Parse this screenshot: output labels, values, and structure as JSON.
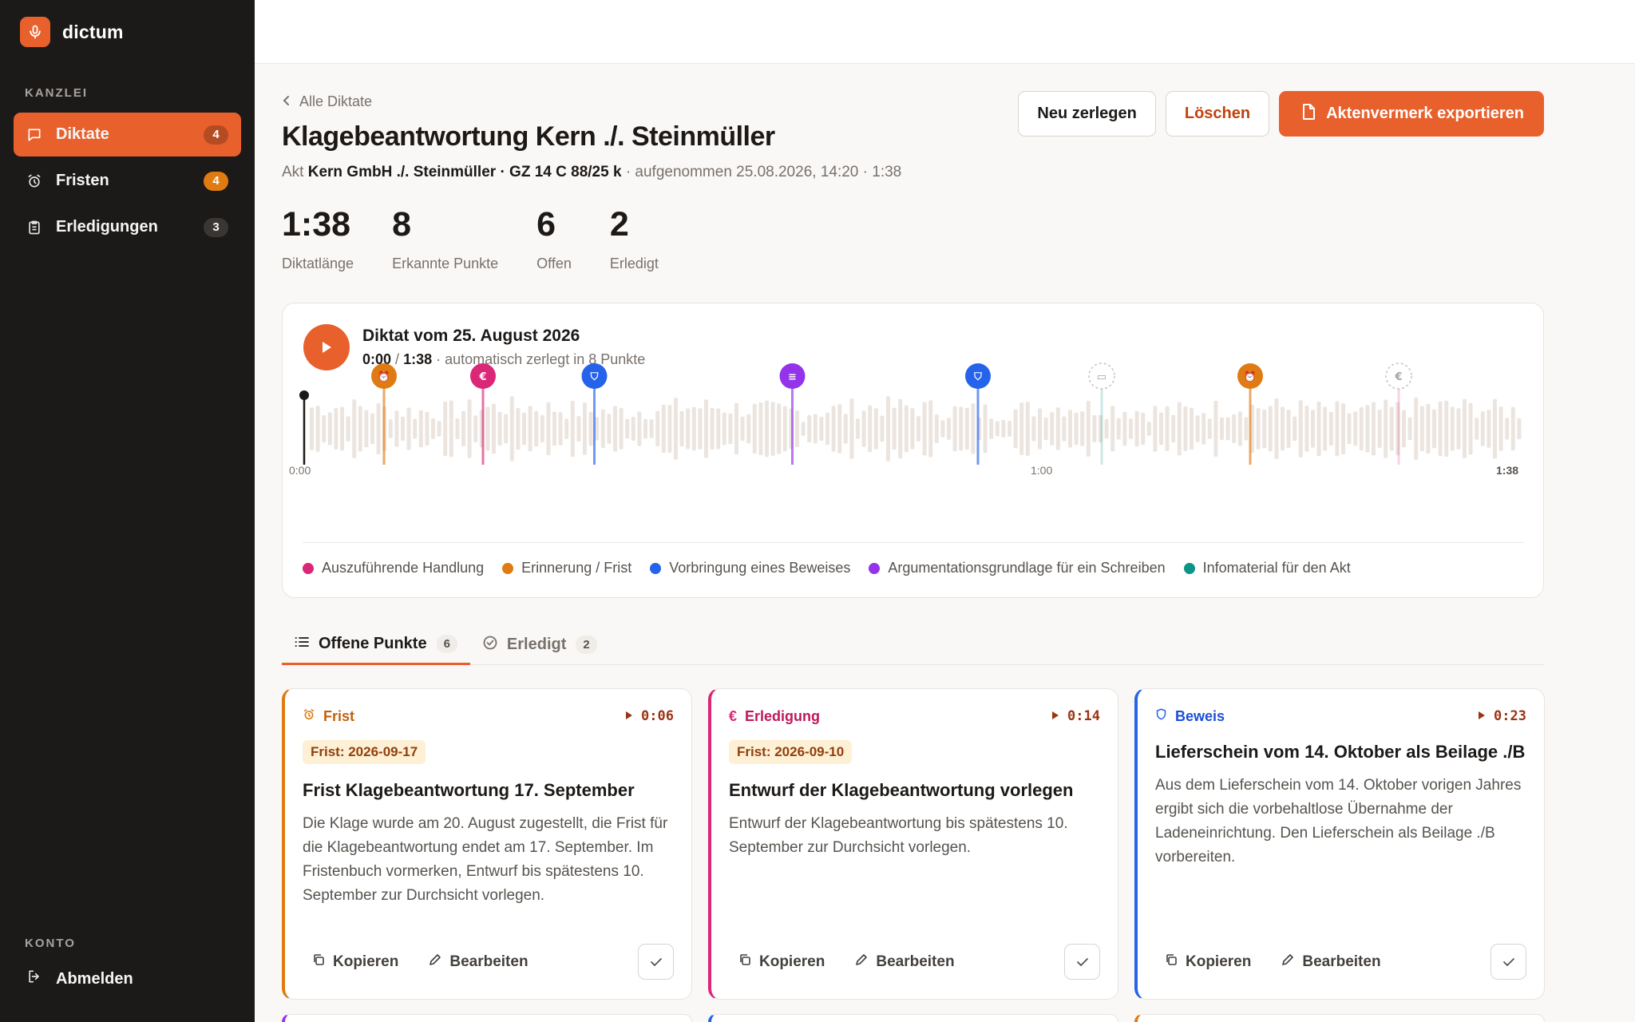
{
  "app": {
    "name": "dictum"
  },
  "sidebar": {
    "section_kanzlei": "KANZLEI",
    "section_konto": "KONTO",
    "items": [
      {
        "label": "Diktate",
        "count": "4",
        "icon": "chat-icon"
      },
      {
        "label": "Fristen",
        "count": "4",
        "icon": "alarm-icon"
      },
      {
        "label": "Erledigungen",
        "count": "3",
        "icon": "clipboard-icon"
      }
    ],
    "logout": "Abmelden"
  },
  "header": {
    "back": "Alle Diktate",
    "title": "Klagebeantwortung Kern ./. Steinmüller",
    "meta_prefix": "Akt",
    "meta_case": "Kern GmbH ./. Steinmüller · GZ 14 C 88/25 k",
    "meta_suffix": "· aufgenommen 25.08.2026, 14:20 · 1:38"
  },
  "actions": {
    "split": "Neu zerlegen",
    "delete": "Löschen",
    "export": "Aktenvermerk exportieren"
  },
  "stats": [
    {
      "value": "1:38",
      "label": "Diktatlänge"
    },
    {
      "value": "8",
      "label": "Erkannte Punkte"
    },
    {
      "value": "6",
      "label": "Offen"
    },
    {
      "value": "2",
      "label": "Erledigt"
    }
  ],
  "player": {
    "title": "Diktat vom 25. August 2026",
    "current": "0:00",
    "separator": "/",
    "total": "1:38",
    "note": "· automatisch zerlegt in 8 Punkte",
    "time_start": "0:00",
    "time_mid": "1:00",
    "time_end": "1:38",
    "duration_seconds": 98,
    "markers": [
      {
        "second": 6,
        "color": "#e07b12",
        "icon": "alarm-icon",
        "done": false
      },
      {
        "second": 14,
        "color": "#db2777",
        "icon": "euro-icon",
        "done": false
      },
      {
        "second": 23,
        "color": "#2563eb",
        "icon": "shield-icon",
        "done": false
      },
      {
        "second": 39,
        "color": "#9333ea",
        "icon": "document-icon",
        "done": false
      },
      {
        "second": 54,
        "color": "#2563eb",
        "icon": "shield-icon",
        "done": false
      },
      {
        "second": 64,
        "color": "#0d9488",
        "icon": "folder-icon",
        "done": true
      },
      {
        "second": 76,
        "color": "#e07b12",
        "icon": "alarm-icon",
        "done": false
      },
      {
        "second": 88,
        "color": "#db2777",
        "icon": "euro-icon",
        "done": true
      }
    ]
  },
  "legend": [
    {
      "label": "Auszuführende Handlung",
      "color": "#db2777"
    },
    {
      "label": "Erinnerung / Frist",
      "color": "#e07b12"
    },
    {
      "label": "Vorbringung eines Beweises",
      "color": "#2563eb"
    },
    {
      "label": "Argumentationsgrundlage für ein Schreiben",
      "color": "#9333ea"
    },
    {
      "label": "Infomaterial für den Akt",
      "color": "#0d9488"
    }
  ],
  "tabs": [
    {
      "label": "Offene Punkte",
      "count": "6"
    },
    {
      "label": "Erledigt",
      "count": "2"
    }
  ],
  "cards": [
    {
      "type": "Frist",
      "color": "#e07b12",
      "icon": "alarm-icon",
      "time": "0:06",
      "deadline": "Frist: 2026-09-17",
      "title": "Frist Klagebeantwortung 17. September",
      "body": "Die Klage wurde am 20. August zugestellt, die Frist für die Klagebeantwortung endet am 17. September. Im Fristenbuch vormerken, Entwurf bis spätestens 10. September zur Durchsicht vorlegen."
    },
    {
      "type": "Erledigung",
      "color": "#db2777",
      "icon": "euro-icon",
      "time": "0:14",
      "deadline": "Frist: 2026-09-10",
      "title": "Entwurf der Klagebeantwortung vorlegen",
      "body": "Entwurf der Klagebeantwortung bis spätestens 10. September zur Durchsicht vorlegen."
    },
    {
      "type": "Beweis",
      "color": "#2563eb",
      "icon": "shield-icon",
      "time": "0:23",
      "deadline": "",
      "title": "Lieferschein vom 14. Oktober als Beilage ./B",
      "body": "Aus dem Lieferschein vom 14. Oktober vorigen Jahres ergibt sich die vorbehaltlose Übernahme der Ladeneinrichtung. Den Lieferschein als Beilage ./B vorbereiten."
    }
  ],
  "card_actions": {
    "copy": "Kopieren",
    "edit": "Bearbeiten"
  },
  "colors": {
    "accent": "#e8602c",
    "sidebar": "#1c1a18"
  }
}
